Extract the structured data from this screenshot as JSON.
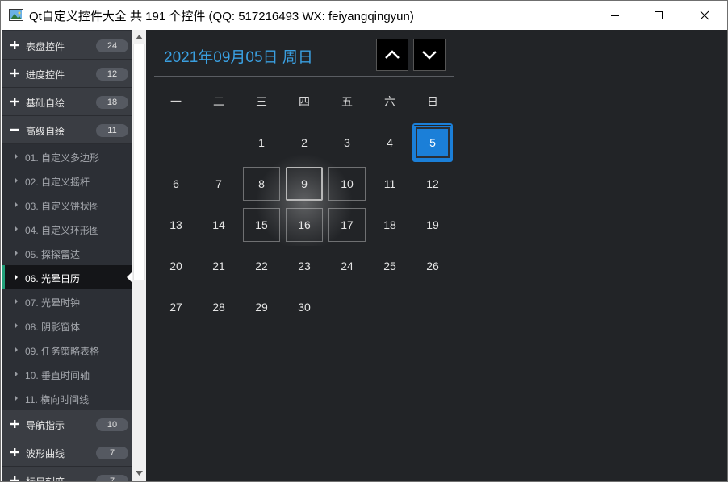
{
  "window": {
    "title": "Qt自定义控件大全 共 191 个控件 (QQ: 517216493 WX: feiyangqingyun)"
  },
  "sidebar": {
    "groups_top": [
      {
        "label": "表盘控件",
        "count": "24",
        "expanded": false
      },
      {
        "label": "进度控件",
        "count": "12",
        "expanded": false
      },
      {
        "label": "基础自绘",
        "count": "18",
        "expanded": false
      },
      {
        "label": "高级自绘",
        "count": "11",
        "expanded": true
      }
    ],
    "children": [
      {
        "label": "01. 自定义多边形"
      },
      {
        "label": "02. 自定义摇杆"
      },
      {
        "label": "03. 自定义饼状图"
      },
      {
        "label": "04. 自定义环形图"
      },
      {
        "label": "05. 探探雷达"
      },
      {
        "label": "06. 光晕日历",
        "active": true
      },
      {
        "label": "07. 光晕时钟"
      },
      {
        "label": "08. 阴影窗体"
      },
      {
        "label": "09. 任务策略表格"
      },
      {
        "label": "10. 垂直时间轴"
      },
      {
        "label": "11. 横向时间线"
      }
    ],
    "groups_bottom": [
      {
        "label": "导航指示",
        "count": "10"
      },
      {
        "label": "波形曲线",
        "count": "7"
      },
      {
        "label": "标尺刻度",
        "count": "7"
      }
    ]
  },
  "calendar": {
    "date_text": "2021年09月05日  周日",
    "weekdays": [
      "一",
      "二",
      "三",
      "四",
      "五",
      "六",
      "日"
    ],
    "weeks": [
      [
        "",
        "",
        "1",
        "2",
        "3",
        "4",
        "5"
      ],
      [
        "6",
        "7",
        "8",
        "9",
        "10",
        "11",
        "12"
      ],
      [
        "13",
        "14",
        "15",
        "16",
        "17",
        "18",
        "19"
      ],
      [
        "20",
        "21",
        "22",
        "23",
        "24",
        "25",
        "26"
      ],
      [
        "27",
        "28",
        "29",
        "30",
        "",
        "",
        ""
      ]
    ],
    "selected_day": "5",
    "hover_day": "9",
    "accent_color": "#1b7fd8",
    "title_color": "#3a9fe0",
    "prev_icon": "chevron-up-icon",
    "next_icon": "chevron-down-icon"
  }
}
